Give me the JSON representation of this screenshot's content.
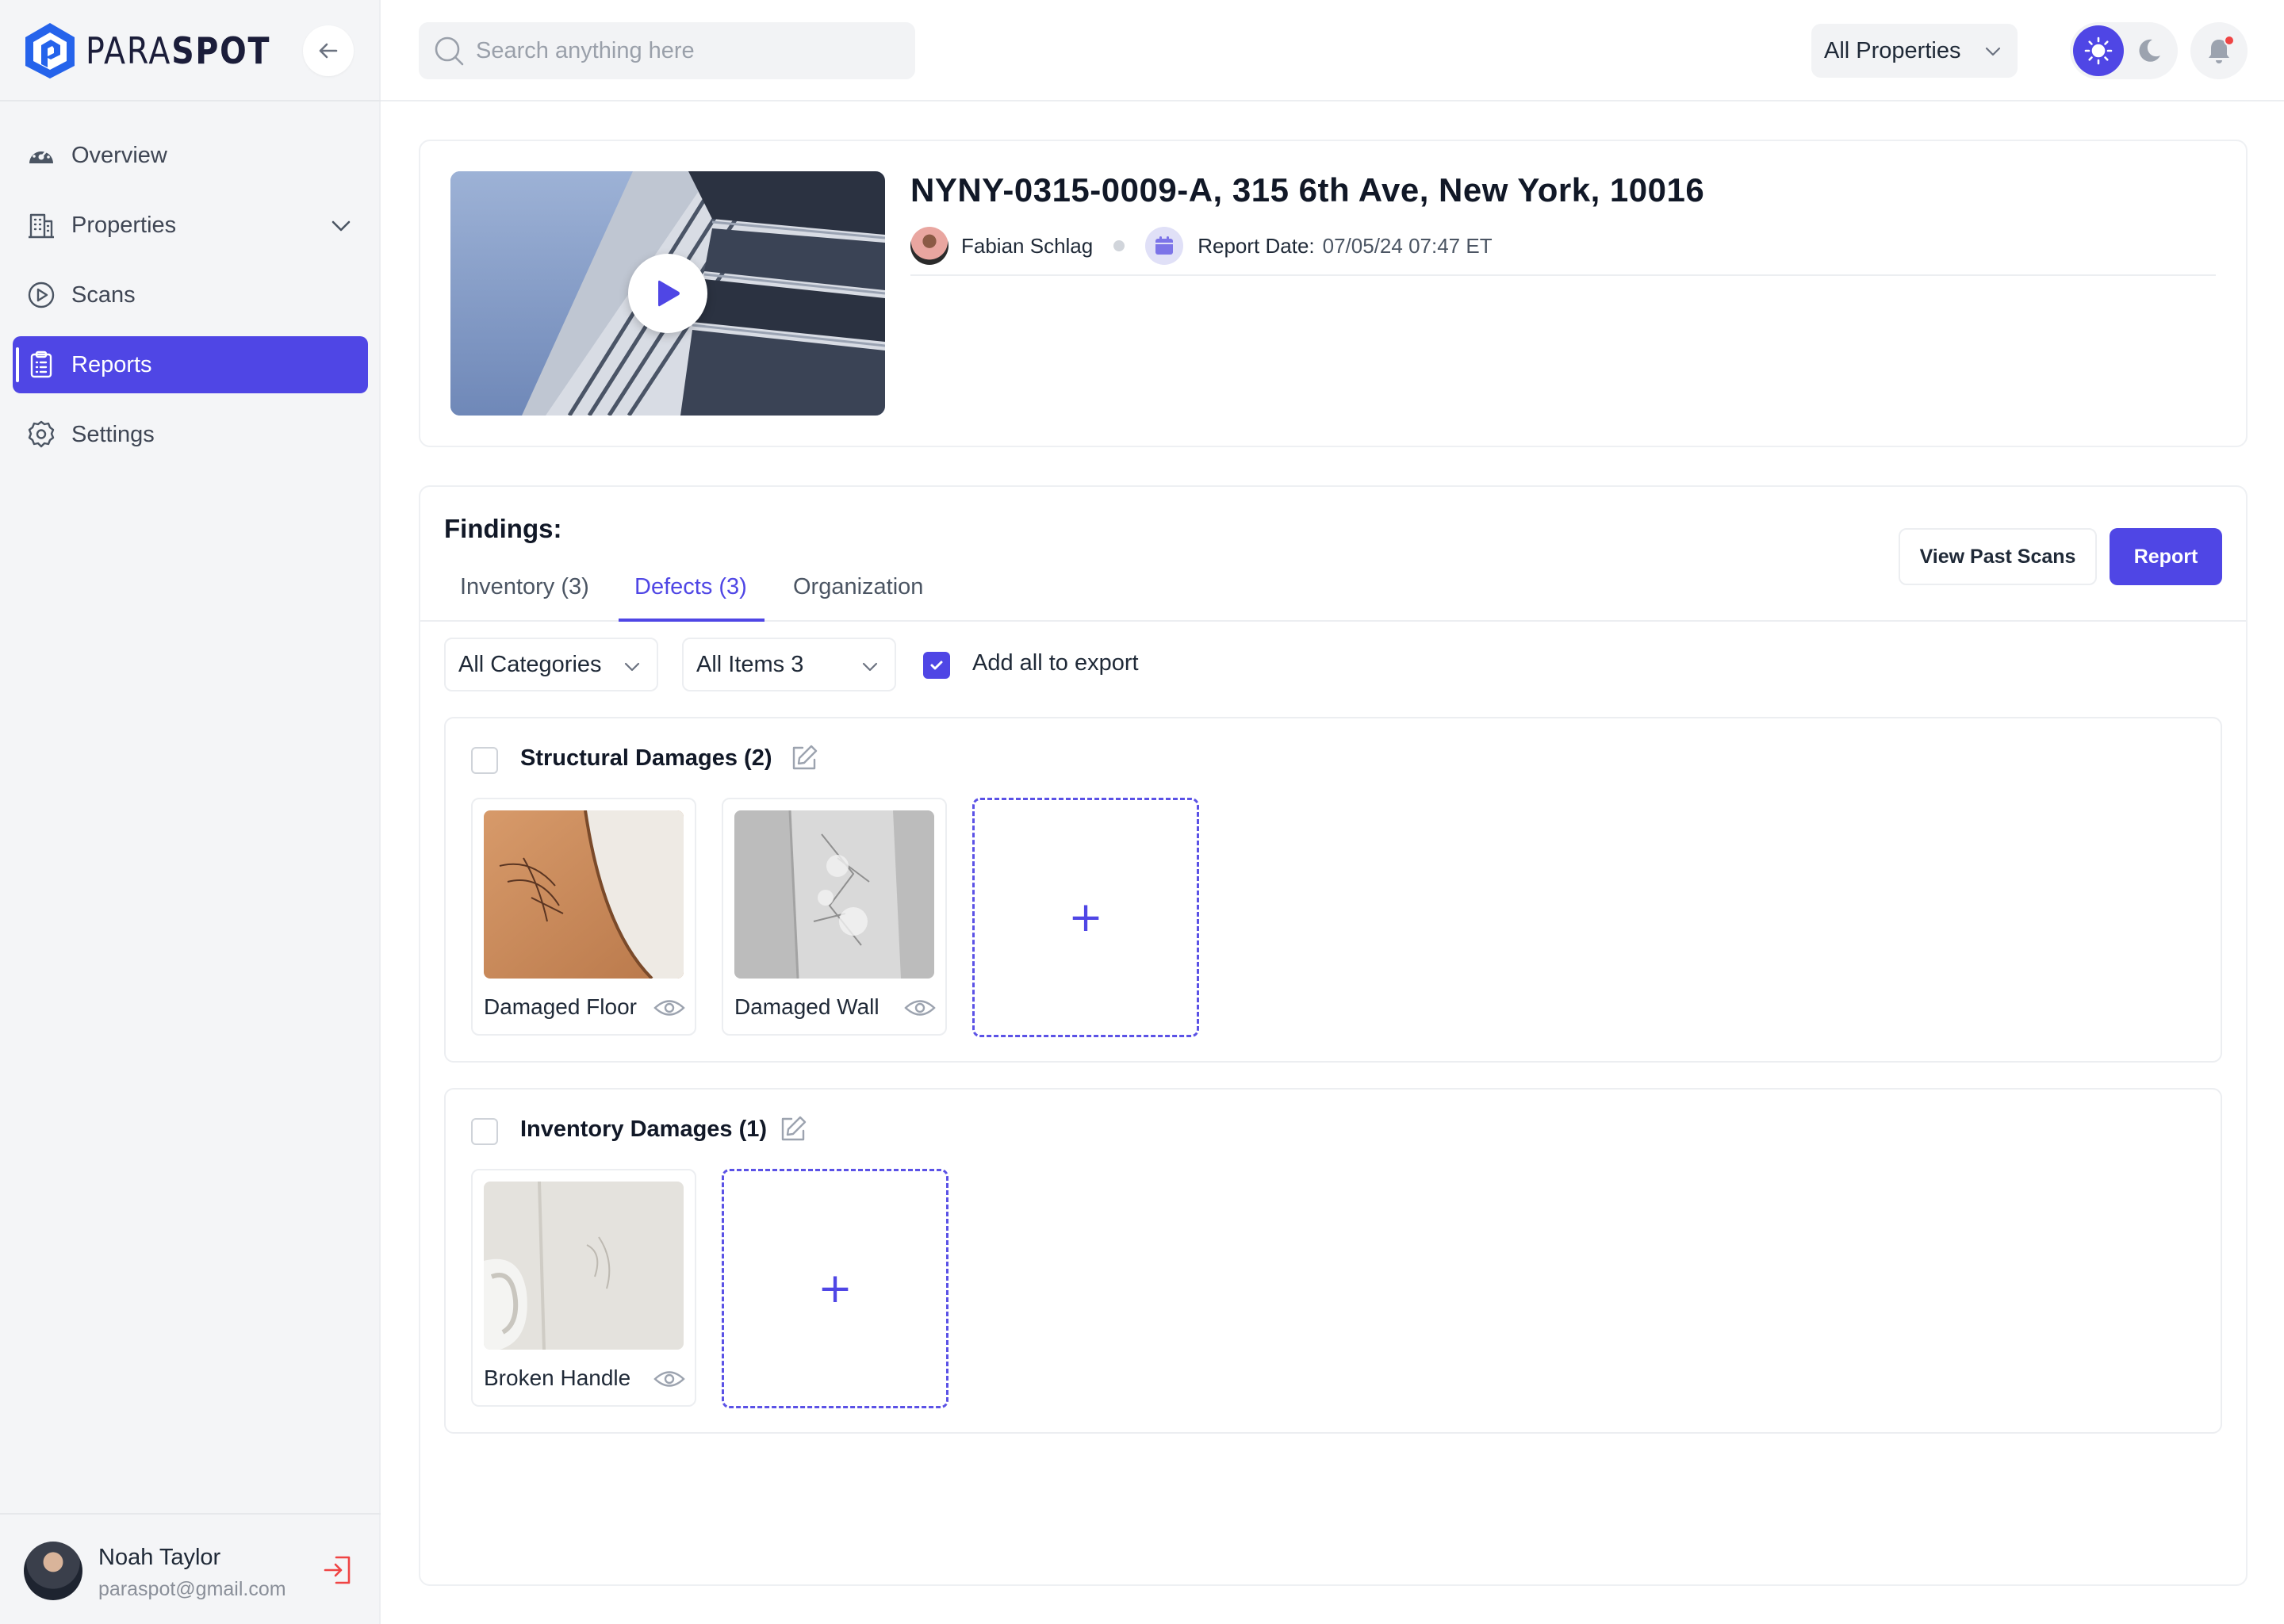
{
  "brand": {
    "name_light": "PARA",
    "name_bold": "SPOT",
    "logo_icon": "paraspot-house-logo",
    "accent": "#2563eb"
  },
  "sidebar": {
    "collapse_icon": "arrow-left-icon",
    "items": [
      {
        "label": "Overview",
        "icon": "dashboard-gauge-icon",
        "active": false
      },
      {
        "label": "Properties",
        "icon": "building-icon",
        "active": false,
        "expandable": true
      },
      {
        "label": "Scans",
        "icon": "play-circle-icon",
        "active": false
      },
      {
        "label": "Reports",
        "icon": "clipboard-icon",
        "active": true
      },
      {
        "label": "Settings",
        "icon": "gear-icon",
        "active": false
      }
    ],
    "user": {
      "name": "Noah Taylor",
      "email": "paraspot@gmail.com",
      "logout_icon": "logout-icon"
    }
  },
  "topbar": {
    "search_placeholder": "Search anything here",
    "property_filter": "All Properties",
    "theme": "light",
    "has_notifications": true
  },
  "report": {
    "title": "NYNY-0315-0009-A, 315 6th Ave, New York, 10016",
    "author": "Fabian Schlag",
    "date_label": "Report Date:",
    "date_value": "07/05/24 07:47 ET"
  },
  "findings": {
    "title": "Findings:",
    "tabs": [
      {
        "label": "Inventory (3)",
        "active": false
      },
      {
        "label": "Defects (3)",
        "active": true
      },
      {
        "label": "Organization",
        "active": false
      }
    ],
    "view_past_scans_label": "View Past Scans",
    "report_label": "Report",
    "category_filter": "All Categories",
    "items_filter": "All Items 3",
    "add_all_to_export_label": "Add all to export",
    "add_all_to_export_checked": true,
    "groups": [
      {
        "title": "Structural Damages (2)",
        "checked": false,
        "items": [
          {
            "label": "Damaged Floor"
          },
          {
            "label": "Damaged Wall"
          }
        ]
      },
      {
        "title": "Inventory Damages (1)",
        "checked": false,
        "items": [
          {
            "label": "Broken Handle"
          }
        ]
      }
    ]
  },
  "colors": {
    "primary": "#4f46e5",
    "notification": "#ef4444"
  }
}
